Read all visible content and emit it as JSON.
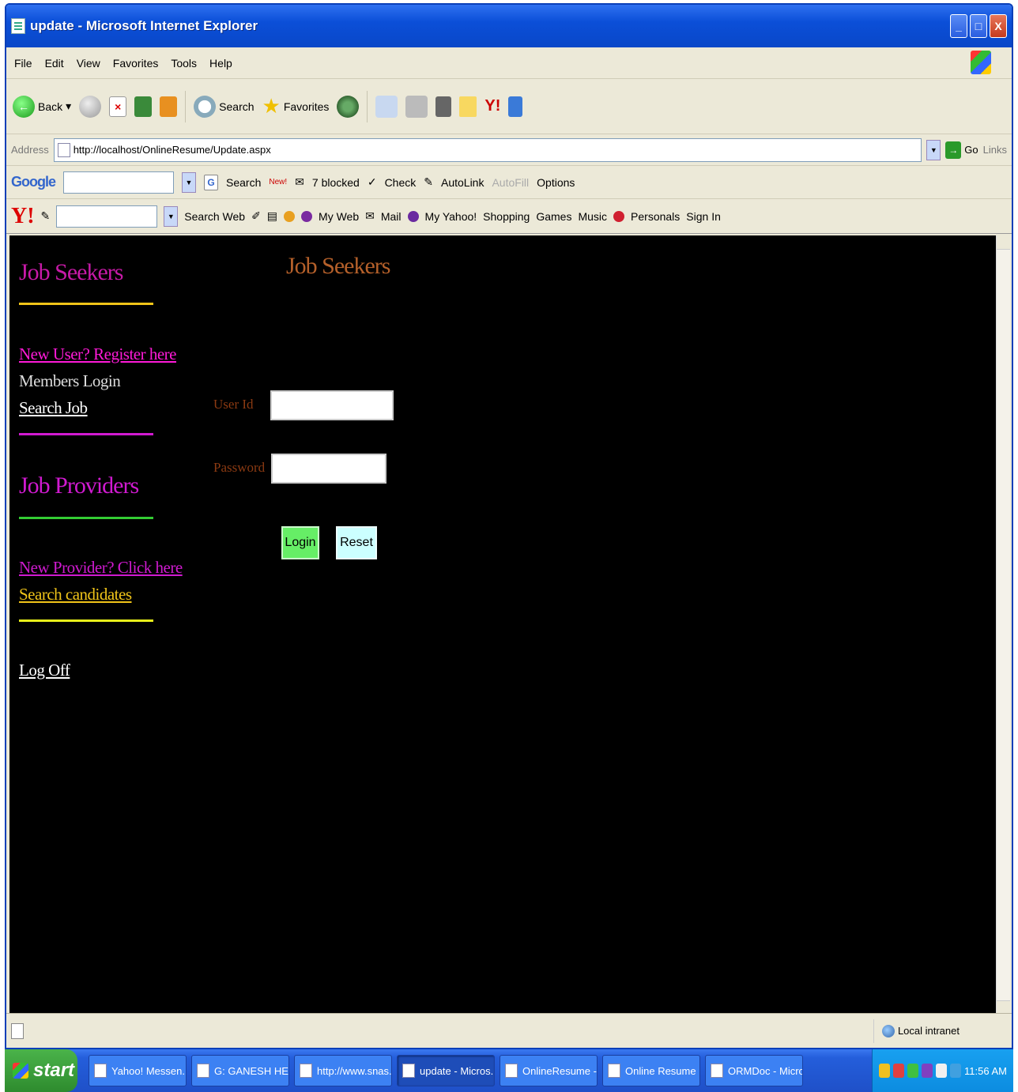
{
  "window": {
    "title": "update - Microsoft Internet Explorer",
    "buttons": {
      "minimize": "_",
      "maximize": "□",
      "close": "X"
    }
  },
  "menu": [
    "File",
    "Edit",
    "View",
    "Favorites",
    "Tools",
    "Help"
  ],
  "toolbar": {
    "back_label": "Back",
    "search_label": "Search",
    "favorites_label": "Favorites"
  },
  "address": {
    "label": "Address",
    "url": "http://localhost/OnlineResume/Update.aspx",
    "go_label": "Go",
    "links_label": "Links"
  },
  "google": {
    "logo": "Google",
    "search_label": "Search",
    "new_badge": "New!",
    "blocked_label": "7 blocked",
    "check_label": "Check",
    "autolink_label": "AutoLink",
    "autofill_label": "AutoFill",
    "options_label": "Options"
  },
  "yahoo": {
    "logo": "Y!",
    "search_web_label": "Search Web",
    "my_web_label": "My Web",
    "mail_label": "Mail",
    "my_yahoo_label": "My Yahoo!",
    "shopping_label": "Shopping",
    "games_label": "Games",
    "music_label": "Music",
    "personals_label": "Personals",
    "sign_in_label": "Sign In"
  },
  "page": {
    "sidebar": {
      "job_seekers_heading": "Job Seekers",
      "new_user_link": "New User? Register here",
      "members_login_link": "Members Login",
      "search_job_link": "Search Job",
      "job_providers_heading": "Job Providers",
      "new_provider_link": "New Provider? Click here",
      "search_candidates_link": "Search candidates",
      "log_off_link": "Log Off"
    },
    "main": {
      "heading": "Job Seekers",
      "user_id_label": "User Id",
      "user_id_value": "",
      "password_label": "Password",
      "password_value": "",
      "login_button": "Login",
      "reset_button": "Reset"
    },
    "colors": {
      "job_seekers_heading": "#c81aa8",
      "main_heading": "#b5602a",
      "hr_yellow": "#f0c419",
      "hr_magenta": "#d01ad0",
      "hr_green": "#33cc33",
      "hr_lime": "#e8f01a",
      "new_user_link": "#ff1ad8",
      "members_login_link": "#dddddd",
      "search_job_link": "#ffffff",
      "job_providers_heading": "#d01ad0",
      "new_provider_link": "#d01ad0",
      "search_candidates_link": "#f0c419",
      "log_off_link": "#ffffff",
      "field_label": "#8b3a12"
    }
  },
  "status": {
    "zone": "Local intranet"
  },
  "taskbar": {
    "start_label": "start",
    "tasks": [
      {
        "label": "Yahoo! Messen..."
      },
      {
        "label": "G: GANESH HE..."
      },
      {
        "label": "http://www.snas..."
      },
      {
        "label": "update - Micros..."
      },
      {
        "label": "OnlineResume -..."
      },
      {
        "label": "Online Resume ..."
      },
      {
        "label": "ORMDoc - Micro..."
      }
    ],
    "clock": "11:56 AM"
  }
}
